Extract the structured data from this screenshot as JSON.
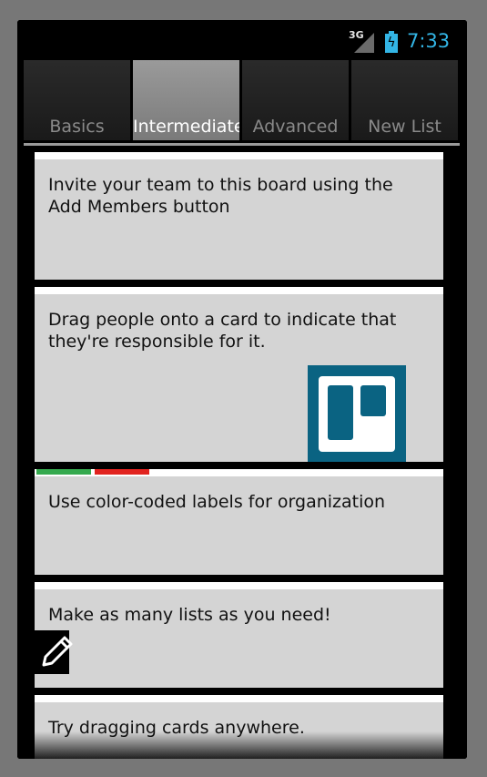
{
  "status_bar": {
    "network": "3G",
    "time": "7:33",
    "accent_color": "#33b5e5"
  },
  "tabs": [
    {
      "label": "Basics",
      "active": false
    },
    {
      "label": "Intermediate",
      "active": true
    },
    {
      "label": "Advanced",
      "active": false
    },
    {
      "label": "New List",
      "active": false
    }
  ],
  "cards": [
    {
      "text": "Invite your team to this board using the Add Members button"
    },
    {
      "text": "Drag people onto a card to indicate that they're responsible for it.",
      "image": "trello-logo"
    },
    {
      "text": "Use color-coded labels for organization",
      "labels": [
        "#35a94e",
        "#e1231f"
      ]
    },
    {
      "text": "Make as many lists as you need!",
      "icon": "edit-icon"
    },
    {
      "text": "Try dragging cards anywhere."
    }
  ]
}
